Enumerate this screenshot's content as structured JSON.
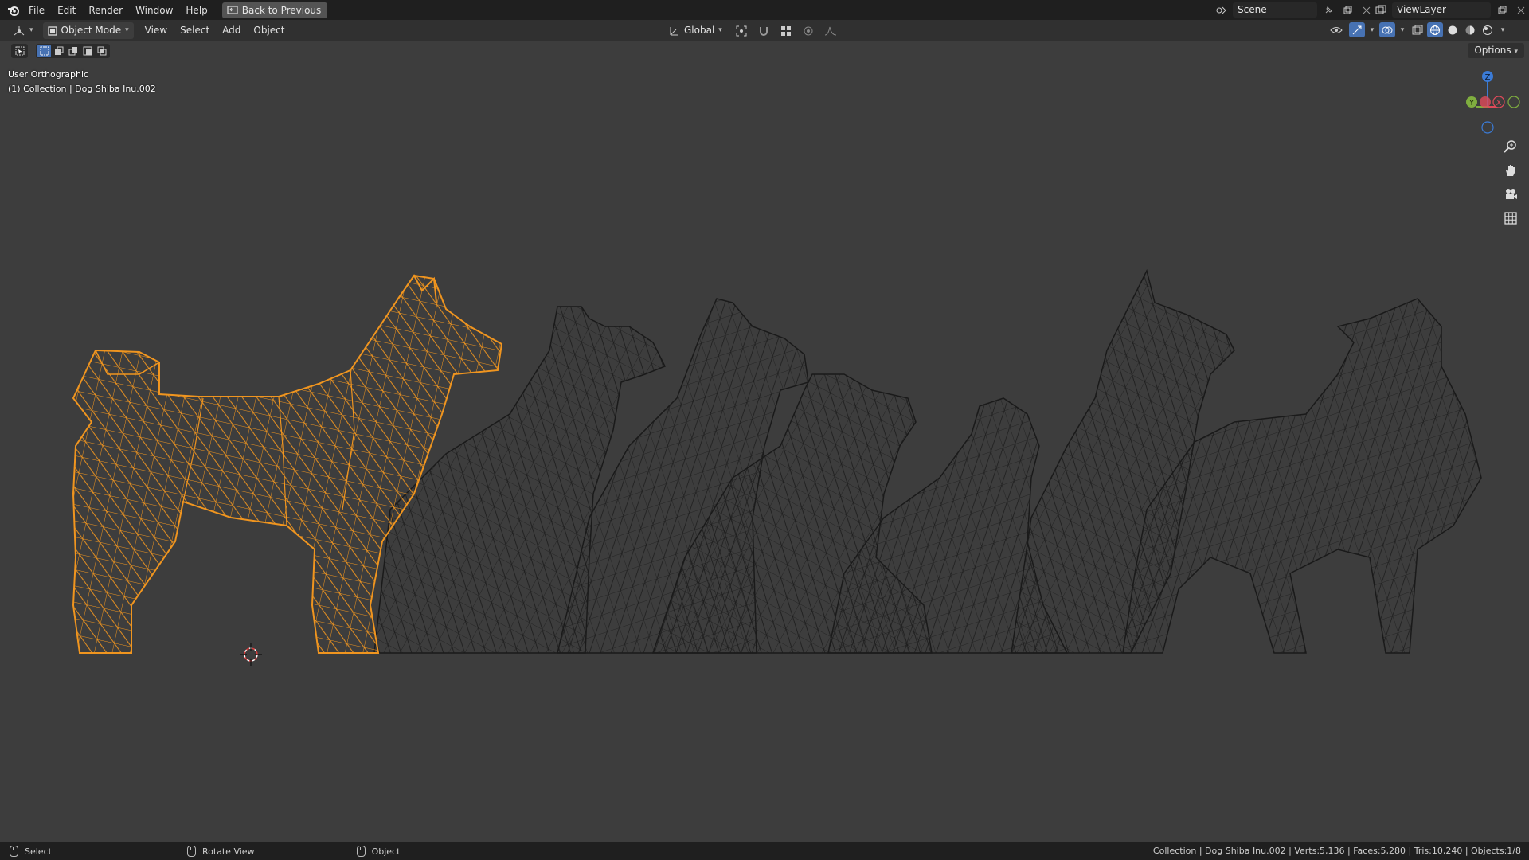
{
  "app": {
    "menu": [
      "File",
      "Edit",
      "Render",
      "Window",
      "Help"
    ],
    "back_button": "Back to Previous",
    "scene_name": "Scene",
    "view_layer": "ViewLayer"
  },
  "header": {
    "mode": "Object Mode",
    "menus": [
      "View",
      "Select",
      "Add",
      "Object"
    ],
    "transform_orientation": "Global",
    "options_label": "Options"
  },
  "viewport": {
    "view_name": "User Orthographic",
    "collection_info": "(1) Collection | Dog Shiba Inu.002",
    "gizmo_labels": {
      "z": "Z",
      "y": "Y",
      "x": "X"
    },
    "selected_color": "#f0951f",
    "wire_color": "#1a1a1a"
  },
  "status": {
    "left": [
      "Select",
      "Rotate View",
      "Object"
    ],
    "right": "Collection | Dog Shiba Inu.002 | Verts:5,136 | Faces:5,280 | Tris:10,240 | Objects:1/8"
  }
}
